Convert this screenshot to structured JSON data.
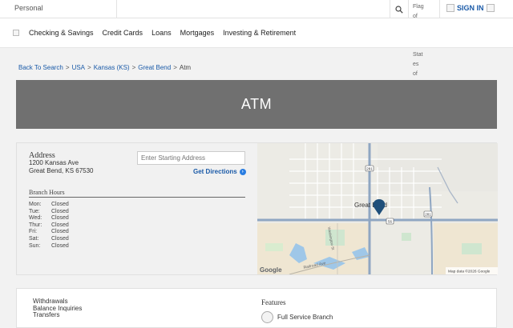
{
  "topbar": {
    "segment_label": "Personal",
    "flag_alt": "Flag of the United States of America",
    "signin_label": "SIGN IN"
  },
  "nav": {
    "items": [
      "Checking & Savings",
      "Credit Cards",
      "Loans",
      "Mortgages",
      "Investing & Retirement"
    ]
  },
  "breadcrumb": {
    "links": [
      "Back To Search",
      "USA",
      "Kansas (KS)",
      "Great Bend"
    ],
    "current": "Atm"
  },
  "banner": {
    "title": "ATM"
  },
  "location": {
    "address_title": "Address",
    "address_line1": "1200 Kansas Ave",
    "address_line2": "Great Bend, KS 67530",
    "start_placeholder": "Enter Starting Address",
    "directions_label": "Get Directions",
    "hours_title": "Branch Hours",
    "hours": [
      {
        "day": "Mon:",
        "value": "Closed"
      },
      {
        "day": "Tue:",
        "value": "Closed"
      },
      {
        "day": "Wed:",
        "value": "Closed"
      },
      {
        "day": "Thur:",
        "value": "Closed"
      },
      {
        "day": "Fri:",
        "value": "Closed"
      },
      {
        "day": "Sat:",
        "value": "Closed"
      },
      {
        "day": "Sun:",
        "value": "Closed"
      }
    ]
  },
  "map": {
    "city_label": "Great Bend",
    "road_label_1": "Washington St",
    "road_label_2": "Railroad Ave",
    "shield_56": "56",
    "shield_281a": "281",
    "shield_281b": "281",
    "google_label": "Google",
    "attribution": "Map data ©2026 Google"
  },
  "services": {
    "items": [
      "Withdrawals",
      "Balance Inquiries",
      "Transfers"
    ],
    "features_title": "Features",
    "feature_item": "Full Service Branch"
  },
  "colors": {
    "link": "#1a5aa8",
    "banner_bg": "#707070",
    "map_pin": "#1f4f7a"
  }
}
